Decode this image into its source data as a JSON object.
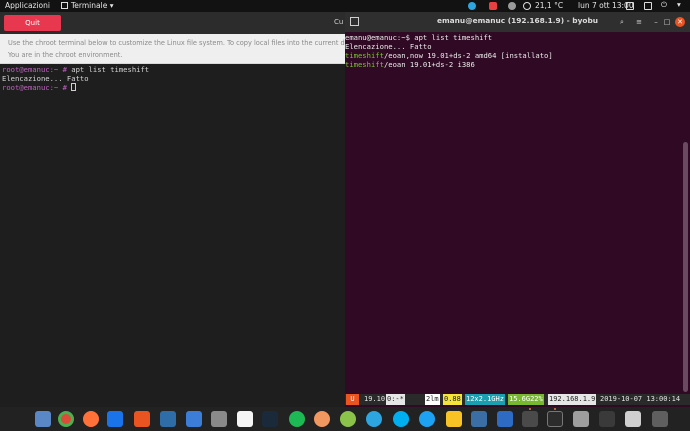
{
  "topbar": {
    "applications": "Applicazioni",
    "terminal_menu": "Terminale ▾",
    "temperature": "21,1 °C",
    "clock": "lun 7 ott  13:00"
  },
  "left_window": {
    "quit_label": "Quit",
    "cut_label": "Cu",
    "info_line1": "Use the chroot terminal below to customize the Linux file system. To copy local files into the current directory",
    "info_line2": "You are in the chroot environment.",
    "terminal": {
      "prompt": "root@emanuc:~ #",
      "command": " apt list timeshift",
      "output1": "Elencazione... Fatto"
    }
  },
  "right_window": {
    "title": "emanu@emanuc (192.168.1.9) - byobu",
    "terminal": {
      "line1": "emanu@emanuc:~$ apt list timeshift",
      "line2": "Elencazione... Fatto",
      "pkg1_name": "timeshift",
      "pkg1_rest": "/eoan,now 19.01+ds-2 amd64 [installato]",
      "pkg2_name": "timeshift",
      "pkg2_rest": "/eoan 19.01+ds-2 i386"
    },
    "status_bar": {
      "logo": "U",
      "version": "19.10",
      "session": "0:-*",
      "memory": "2lm",
      "load": "0.88",
      "cpu": "12x2.1GHz",
      "disk": "15.6G22%",
      "ip": "192.168.1.9",
      "datetime": "2019-10-07 13:00:14"
    }
  },
  "dock": {
    "apps": [
      "files",
      "chrome",
      "firefox",
      "thunderbird",
      "software",
      "virtualbox",
      "libreoffice-writer",
      "text-editor",
      "gedit",
      "steam",
      "spotify",
      "geary",
      "vim",
      "telegram",
      "skype",
      "twitter",
      "keep",
      "kdenlive",
      "transmission",
      "terminal",
      "nautilus",
      "calculator"
    ]
  }
}
